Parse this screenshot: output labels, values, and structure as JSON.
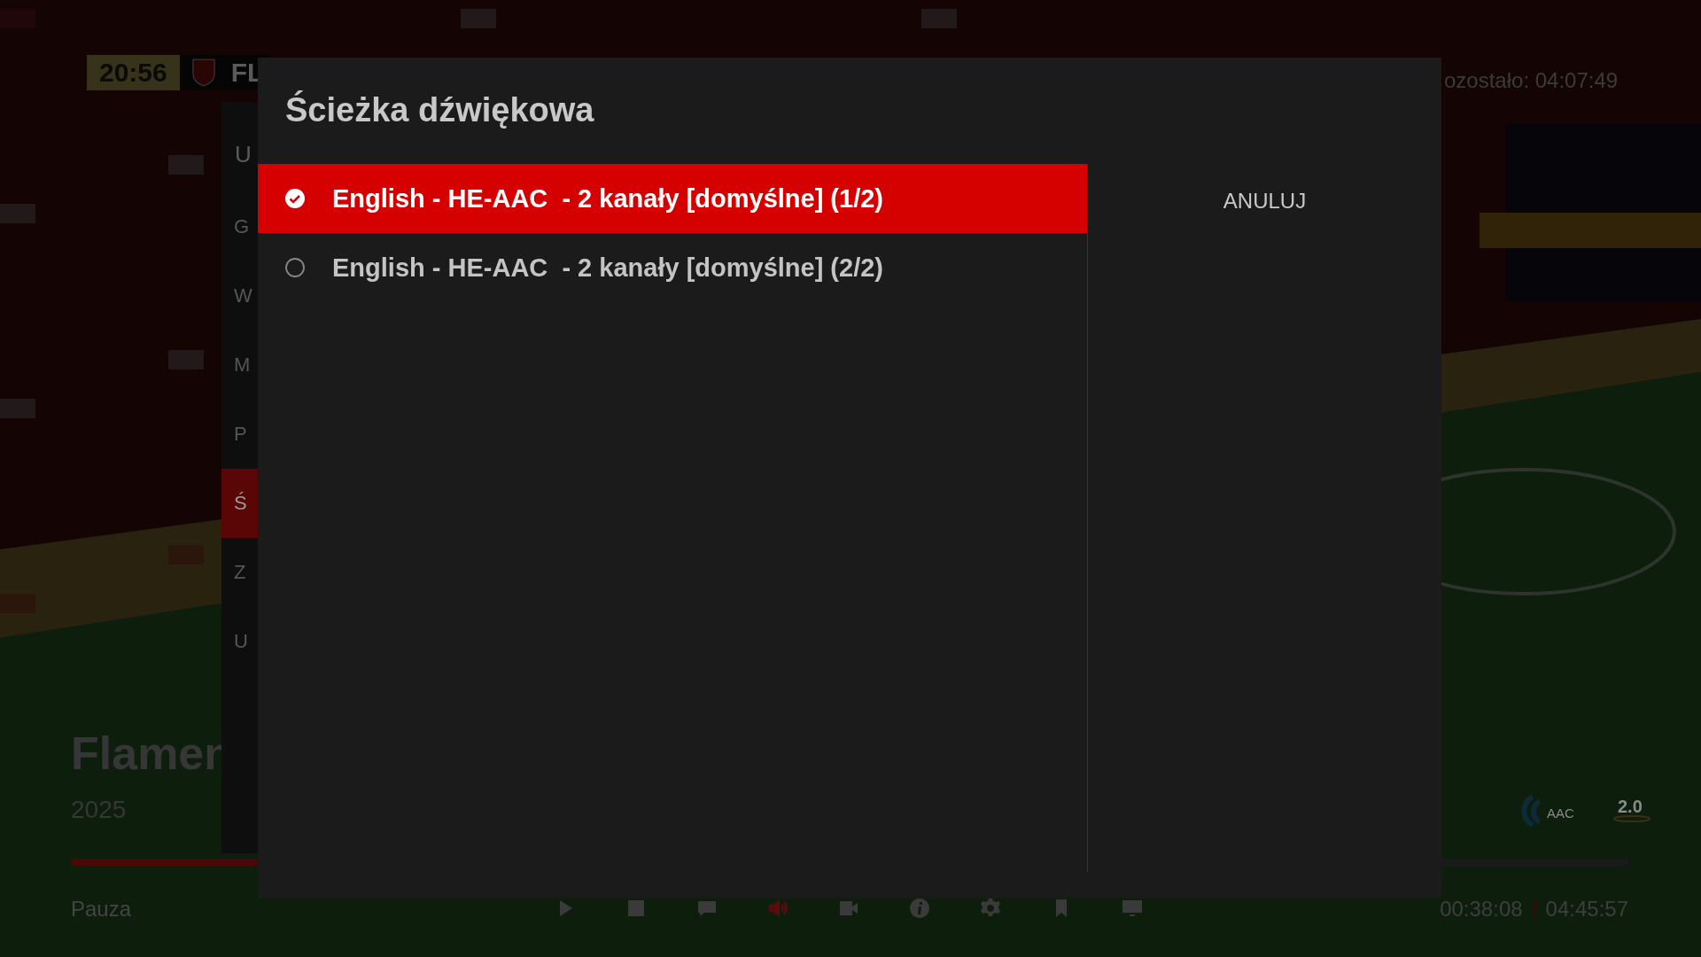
{
  "player": {
    "clock": "20:56",
    "team": "FL",
    "remaining": "ozostało: 04:07:49",
    "title": "Flamen",
    "year": "2025",
    "progress": {
      "level": 0.12
    },
    "codecs": [
      {
        "kind": "aac",
        "label": "AAC"
      },
      {
        "kind": "channels",
        "label": "2.0"
      }
    ],
    "status": "Pauza",
    "controls": [
      {
        "kind": "play",
        "selected": false
      },
      {
        "kind": "stop",
        "selected": false
      },
      {
        "kind": "chat",
        "selected": false
      },
      {
        "kind": "audio",
        "selected": true
      },
      {
        "kind": "camera",
        "selected": false
      },
      {
        "kind": "info",
        "selected": false
      },
      {
        "kind": "settings",
        "selected": false
      },
      {
        "kind": "bookmark",
        "selected": false
      },
      {
        "kind": "monitor",
        "selected": false
      }
    ],
    "elapsed": "00:38:08",
    "duration": "04:45:57"
  },
  "menu": {
    "title": "U",
    "items": [
      {
        "label": "G",
        "selected": false
      },
      {
        "label": "W",
        "selected": false
      },
      {
        "label": "M",
        "selected": false
      },
      {
        "label": "P",
        "selected": false
      },
      {
        "label": "Ś",
        "selected": true
      },
      {
        "label": "Z",
        "selected": false
      },
      {
        "label": "U",
        "selected": false
      }
    ]
  },
  "dialog": {
    "title": "Ścieżka dźwiękowa",
    "tracks": [
      {
        "label": "English - HE-AAC  - 2 kanały [domyślne] (1/2)",
        "selected": true
      },
      {
        "label": "English - HE-AAC  - 2 kanały [domyślne] (2/2)",
        "selected": false
      }
    ],
    "cancel": "ANULUJ"
  }
}
